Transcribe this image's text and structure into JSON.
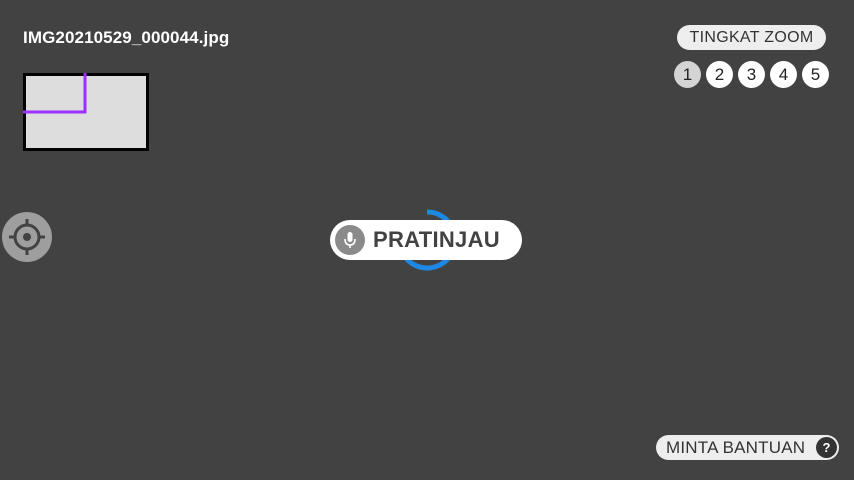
{
  "file": {
    "name": "IMG20210529_000044.jpg"
  },
  "minimap": {
    "icon": "minimap-viewport"
  },
  "recenter": {
    "icon": "crosshair-icon"
  },
  "zoom": {
    "label": "TINGKAT ZOOM",
    "levels": [
      "1",
      "2",
      "3",
      "4",
      "5"
    ],
    "active_level": "1"
  },
  "preview": {
    "label": "PRATINJAU",
    "icon": "mic-icon",
    "spinner_color": "#1e88e5"
  },
  "help": {
    "label": "MINTA BANTUAN",
    "icon_glyph": "?"
  },
  "colors": {
    "background": "#424242",
    "minimap_marker": "#9b30ff"
  }
}
